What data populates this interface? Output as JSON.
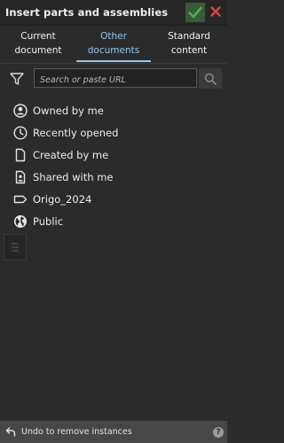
{
  "header": {
    "title": "Insert parts and assemblies",
    "ok_icon": "checkmark-icon",
    "close_icon": "close-icon"
  },
  "tabs": [
    {
      "line1": "Current",
      "line2": "document",
      "active": false
    },
    {
      "line1": "Other",
      "line2": "documents",
      "active": true
    },
    {
      "line1": "Standard",
      "line2": "content",
      "active": false
    }
  ],
  "search": {
    "placeholder": "Search or paste URL"
  },
  "filters": [
    {
      "label": "Owned by me",
      "icon": "user-circle-icon"
    },
    {
      "label": "Recently opened",
      "icon": "clock-icon"
    },
    {
      "label": "Created by me",
      "icon": "document-icon"
    },
    {
      "label": "Shared with me",
      "icon": "shared-user-icon"
    },
    {
      "label": "Origo_2024",
      "icon": "label-tag-icon"
    },
    {
      "label": "Public",
      "icon": "globe-icon"
    }
  ],
  "footer": {
    "undo_label": "Undo to remove instances",
    "help": "?"
  },
  "colors": {
    "accent": "#8ec8ee",
    "ok_green": "#4caf50",
    "close_red": "#e0443a",
    "background": "#2b2b2b"
  }
}
